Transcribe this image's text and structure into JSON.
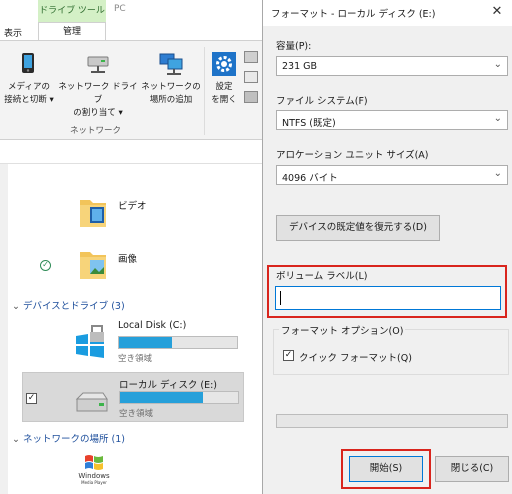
{
  "explorer": {
    "tabs": {
      "context_header": "ドライブ ツール",
      "pc": "PC",
      "view": "表示",
      "manage": "管理"
    },
    "ribbon": {
      "media_label": "メディアの\n接続と切断 ▾",
      "map_drive_label": "ネットワーク ドライブ\nの割り当て ▾",
      "add_location_label": "ネットワークの\n場所の追加",
      "settings_label": "設定\nを開く",
      "group_label": "ネットワーク"
    },
    "folders": [
      {
        "name": "ビデオ"
      },
      {
        "name": "画像"
      }
    ],
    "devices_section": "デバイスとドライブ (3)",
    "drives": [
      {
        "name": "Local Disk (C:)",
        "free_label": "空き領域",
        "used_fraction": 0.45
      },
      {
        "name": "ローカル ディスク (E:)",
        "free_label": "空き領域",
        "used_fraction": 0.7
      }
    ],
    "network_section": "ネットワークの場所 (1)",
    "media_player": {
      "logo_line1": "Windows",
      "logo_line2": "Media Player"
    }
  },
  "dialog": {
    "title": "フォーマット - ローカル ディスク (E:)",
    "close_glyph": "✕",
    "capacity": {
      "label": "容量(P):",
      "value": "231 GB"
    },
    "filesystem": {
      "label": "ファイル システム(F)",
      "value": "NTFS (既定)"
    },
    "allocation": {
      "label": "アロケーション ユニット サイズ(A)",
      "value": "4096 バイト"
    },
    "restore_button": "デバイスの既定値を復元する(D)",
    "volume_label": {
      "label": "ボリューム ラベル(L)",
      "value": ""
    },
    "options": {
      "title": "フォーマット オプション(O)",
      "quick_format": "クイック フォーマット(Q)",
      "quick_checked": true
    },
    "progress": 0,
    "start_button": "開始(S)",
    "close_button": "閉じる(C)"
  },
  "colors": {
    "accent": "#0078d7",
    "highlight": "#d9251d",
    "drive_bar": "#26a0da",
    "context_tab": "#d4f0c6"
  }
}
